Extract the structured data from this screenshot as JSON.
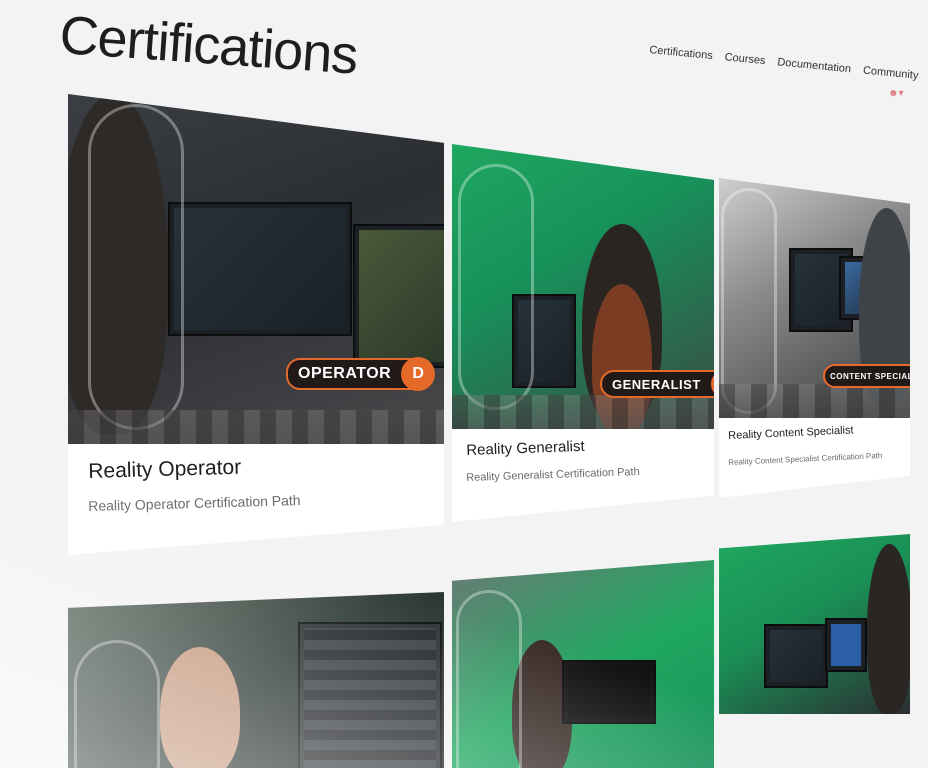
{
  "page": {
    "title": "Certifications"
  },
  "nav": {
    "items": [
      "Certifications",
      "Courses",
      "Documentation",
      "Community"
    ],
    "user_icon": "user-icon"
  },
  "cards": [
    {
      "title": "Reality Operator",
      "subtitle": "Reality Operator Certification Path",
      "badge": "OPERATOR"
    },
    {
      "title": "Reality Generalist",
      "subtitle": "Reality Generalist Certification Path",
      "badge": "GENERALIST"
    },
    {
      "title": "Reality Content Specialist",
      "subtitle": "Reality Content Specialist Certification Path",
      "badge": "CONTENT SPECIALIST"
    }
  ],
  "colors": {
    "accent": "#e56a2a",
    "badge_bg": "#221a18",
    "green_screen": "#1fa860"
  }
}
